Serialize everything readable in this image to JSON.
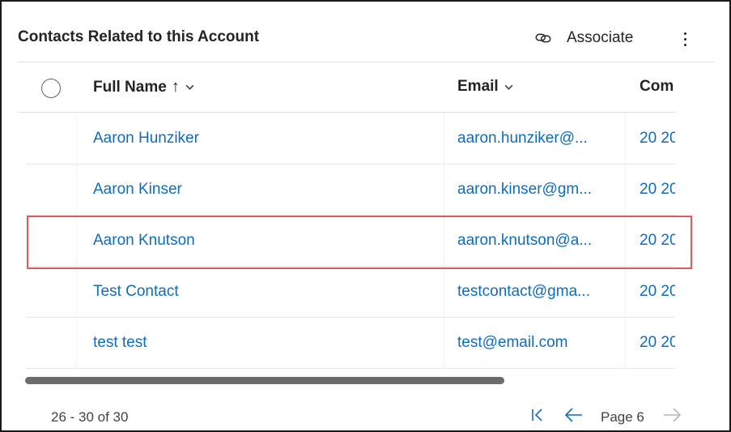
{
  "header": {
    "title": "Contacts Related to this Account",
    "associate_label": "Associate"
  },
  "grid": {
    "columns": [
      {
        "label": "Full Name",
        "sort_glyph": "↑"
      },
      {
        "label": "Email"
      },
      {
        "label": "Com"
      }
    ],
    "rows": [
      {
        "full_name": "Aaron Hunziker",
        "email": "aaron.hunziker@...",
        "company": "20 20"
      },
      {
        "full_name": "Aaron Kinser",
        "email": "aaron.kinser@gm...",
        "company": "20 20"
      },
      {
        "full_name": "Aaron Knutson",
        "email": "aaron.knutson@a...",
        "company": "20 20"
      },
      {
        "full_name": "Test Contact",
        "email": "testcontact@gma...",
        "company": "20 20"
      },
      {
        "full_name": "test test",
        "email": "test@email.com",
        "company": "20 20"
      }
    ]
  },
  "footer": {
    "record_count": "26 - 30 of 30",
    "page_label": "Page 6"
  },
  "colors": {
    "link": "#0f6cbd",
    "highlight_border": "#e05a5a",
    "text": "#242424"
  },
  "icons": {
    "associate": "link-icon",
    "more": "more-vertical-icon",
    "first_page": "first-page-icon",
    "prev_page": "arrow-left-icon",
    "next_page": "arrow-right-icon"
  }
}
